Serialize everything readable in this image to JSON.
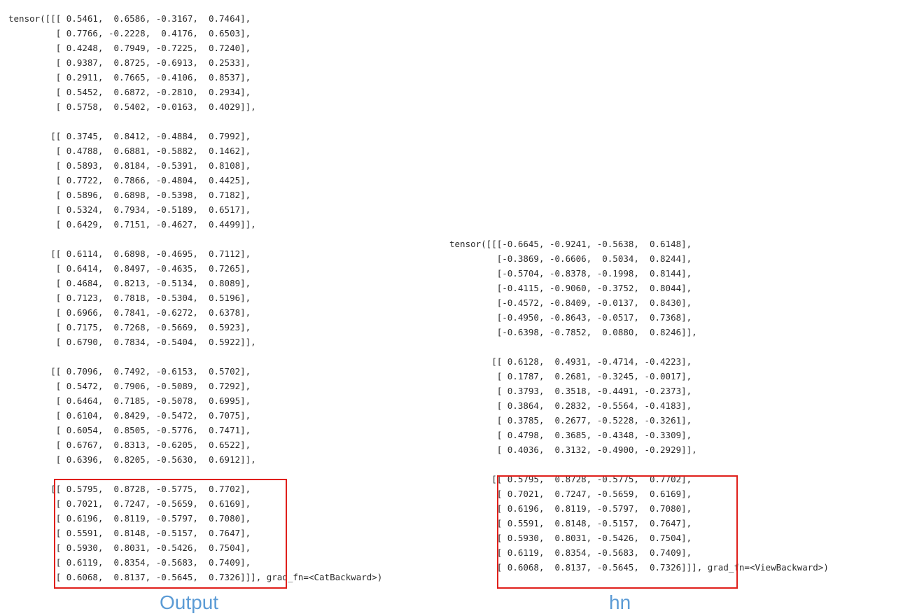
{
  "output": {
    "prefix": "tensor(",
    "grad_fn": "grad_fn=<CatBackward>",
    "caption": "Output",
    "blocks": [
      [
        [
          "0.5461",
          "0.6586",
          "-0.3167",
          "0.7464"
        ],
        [
          "0.7766",
          "-0.2228",
          "0.4176",
          "0.6503"
        ],
        [
          "0.4248",
          "0.7949",
          "-0.7225",
          "0.7240"
        ],
        [
          "0.9387",
          "0.8725",
          "-0.6913",
          "0.2533"
        ],
        [
          "0.2911",
          "0.7665",
          "-0.4106",
          "0.8537"
        ],
        [
          "0.5452",
          "0.6872",
          "-0.2810",
          "0.2934"
        ],
        [
          "0.5758",
          "0.5402",
          "-0.0163",
          "0.4029"
        ]
      ],
      [
        [
          "0.3745",
          "0.8412",
          "-0.4884",
          "0.7992"
        ],
        [
          "0.4788",
          "0.6881",
          "-0.5882",
          "0.1462"
        ],
        [
          "0.5893",
          "0.8184",
          "-0.5391",
          "0.8108"
        ],
        [
          "0.7722",
          "0.7866",
          "-0.4804",
          "0.4425"
        ],
        [
          "0.5896",
          "0.6898",
          "-0.5398",
          "0.7182"
        ],
        [
          "0.5324",
          "0.7934",
          "-0.5189",
          "0.6517"
        ],
        [
          "0.6429",
          "0.7151",
          "-0.4627",
          "0.4499"
        ]
      ],
      [
        [
          "0.6114",
          "0.6898",
          "-0.4695",
          "0.7112"
        ],
        [
          "0.6414",
          "0.8497",
          "-0.4635",
          "0.7265"
        ],
        [
          "0.4684",
          "0.8213",
          "-0.5134",
          "0.8089"
        ],
        [
          "0.7123",
          "0.7818",
          "-0.5304",
          "0.5196"
        ],
        [
          "0.6966",
          "0.7841",
          "-0.6272",
          "0.6378"
        ],
        [
          "0.7175",
          "0.7268",
          "-0.5669",
          "0.5923"
        ],
        [
          "0.6790",
          "0.7834",
          "-0.5404",
          "0.5922"
        ]
      ],
      [
        [
          "0.7096",
          "0.7492",
          "-0.6153",
          "0.5702"
        ],
        [
          "0.5472",
          "0.7906",
          "-0.5089",
          "0.7292"
        ],
        [
          "0.6464",
          "0.7185",
          "-0.5078",
          "0.6995"
        ],
        [
          "0.6104",
          "0.8429",
          "-0.5472",
          "0.7075"
        ],
        [
          "0.6054",
          "0.8505",
          "-0.5776",
          "0.7471"
        ],
        [
          "0.6767",
          "0.8313",
          "-0.6205",
          "0.6522"
        ],
        [
          "0.6396",
          "0.8205",
          "-0.5630",
          "0.6912"
        ]
      ],
      [
        [
          "0.5795",
          "0.8728",
          "-0.5775",
          "0.7702"
        ],
        [
          "0.7021",
          "0.7247",
          "-0.5659",
          "0.6169"
        ],
        [
          "0.6196",
          "0.8119",
          "-0.5797",
          "0.7080"
        ],
        [
          "0.5591",
          "0.8148",
          "-0.5157",
          "0.7647"
        ],
        [
          "0.5930",
          "0.8031",
          "-0.5426",
          "0.7504"
        ],
        [
          "0.6119",
          "0.8354",
          "-0.5683",
          "0.7409"
        ],
        [
          "0.6068",
          "0.8137",
          "-0.5645",
          "0.7326"
        ]
      ]
    ]
  },
  "hn": {
    "prefix": "tensor(",
    "grad_fn": "grad_fn=<ViewBackward>",
    "caption": "hn",
    "blocks": [
      [
        [
          "-0.6645",
          "-0.9241",
          "-0.5638",
          "0.6148"
        ],
        [
          "-0.3869",
          "-0.6606",
          "0.5034",
          "0.8244"
        ],
        [
          "-0.5704",
          "-0.8378",
          "-0.1998",
          "0.8144"
        ],
        [
          "-0.4115",
          "-0.9060",
          "-0.3752",
          "0.8044"
        ],
        [
          "-0.4572",
          "-0.8409",
          "-0.0137",
          "0.8430"
        ],
        [
          "-0.4950",
          "-0.8643",
          "-0.0517",
          "0.7368"
        ],
        [
          "-0.6398",
          "-0.7852",
          "0.0880",
          "0.8246"
        ]
      ],
      [
        [
          "0.6128",
          "0.4931",
          "-0.4714",
          "-0.4223"
        ],
        [
          "0.1787",
          "0.2681",
          "-0.3245",
          "-0.0017"
        ],
        [
          "0.3793",
          "0.3518",
          "-0.4491",
          "-0.2373"
        ],
        [
          "0.3864",
          "0.2832",
          "-0.5564",
          "-0.4183"
        ],
        [
          "0.3785",
          "0.2677",
          "-0.5228",
          "-0.3261"
        ],
        [
          "0.4798",
          "0.3685",
          "-0.4348",
          "-0.3309"
        ],
        [
          "0.4036",
          "0.3132",
          "-0.4900",
          "-0.2929"
        ]
      ],
      [
        [
          "0.5795",
          "0.8728",
          "-0.5775",
          "0.7702"
        ],
        [
          "0.7021",
          "0.7247",
          "-0.5659",
          "0.6169"
        ],
        [
          "0.6196",
          "0.8119",
          "-0.5797",
          "0.7080"
        ],
        [
          "0.5591",
          "0.8148",
          "-0.5157",
          "0.7647"
        ],
        [
          "0.5930",
          "0.8031",
          "-0.5426",
          "0.7504"
        ],
        [
          "0.6119",
          "0.8354",
          "-0.5683",
          "0.7409"
        ],
        [
          "0.6068",
          "0.8137",
          "-0.5645",
          "0.7326"
        ]
      ]
    ]
  }
}
